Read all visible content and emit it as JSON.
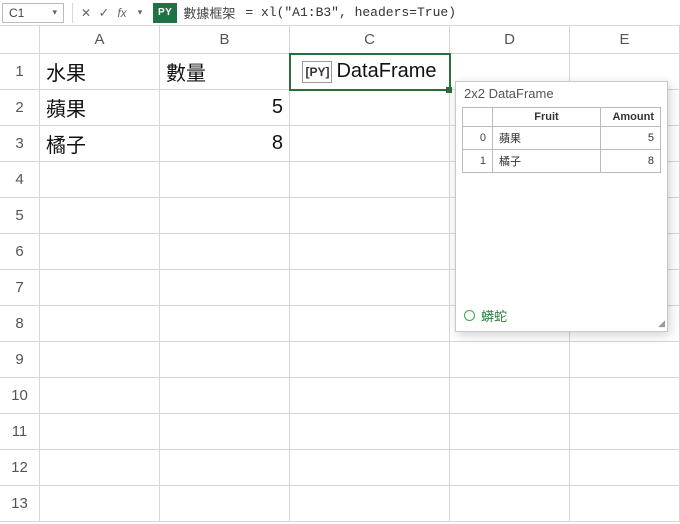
{
  "formula_bar": {
    "cell_ref": "C1",
    "py_label": "PY",
    "py_text": "數據框架",
    "formula": "= xl(\"A1:B3\", headers=True)"
  },
  "columns": [
    "A",
    "B",
    "C",
    "D",
    "E"
  ],
  "rows": [
    "1",
    "2",
    "3",
    "4",
    "5",
    "6",
    "7",
    "8",
    "9",
    "10",
    "11",
    "12",
    "13"
  ],
  "cells": {
    "A1": "水果",
    "B1": "數量",
    "A2": "蘋果",
    "B2": "5",
    "A3": "橘子",
    "B3": "8"
  },
  "c1_chip": {
    "chip": "[PY]",
    "text": "DataFrame"
  },
  "card": {
    "title": "2x2 DataFrame",
    "headers": {
      "idx": "",
      "fruit": "Fruit",
      "amount": "Amount"
    },
    "rows": [
      {
        "idx": "0",
        "fruit": "蘋果",
        "amount": "5"
      },
      {
        "idx": "1",
        "fruit": "橘子",
        "amount": "8"
      }
    ],
    "footer": "蟒蛇"
  },
  "chart_data": {
    "type": "table",
    "title": "2x2 DataFrame",
    "columns": [
      "Fruit",
      "Amount"
    ],
    "index": [
      0,
      1
    ],
    "rows": [
      {
        "Fruit": "蘋果",
        "Amount": 5
      },
      {
        "Fruit": "橘子",
        "Amount": 8
      }
    ]
  }
}
